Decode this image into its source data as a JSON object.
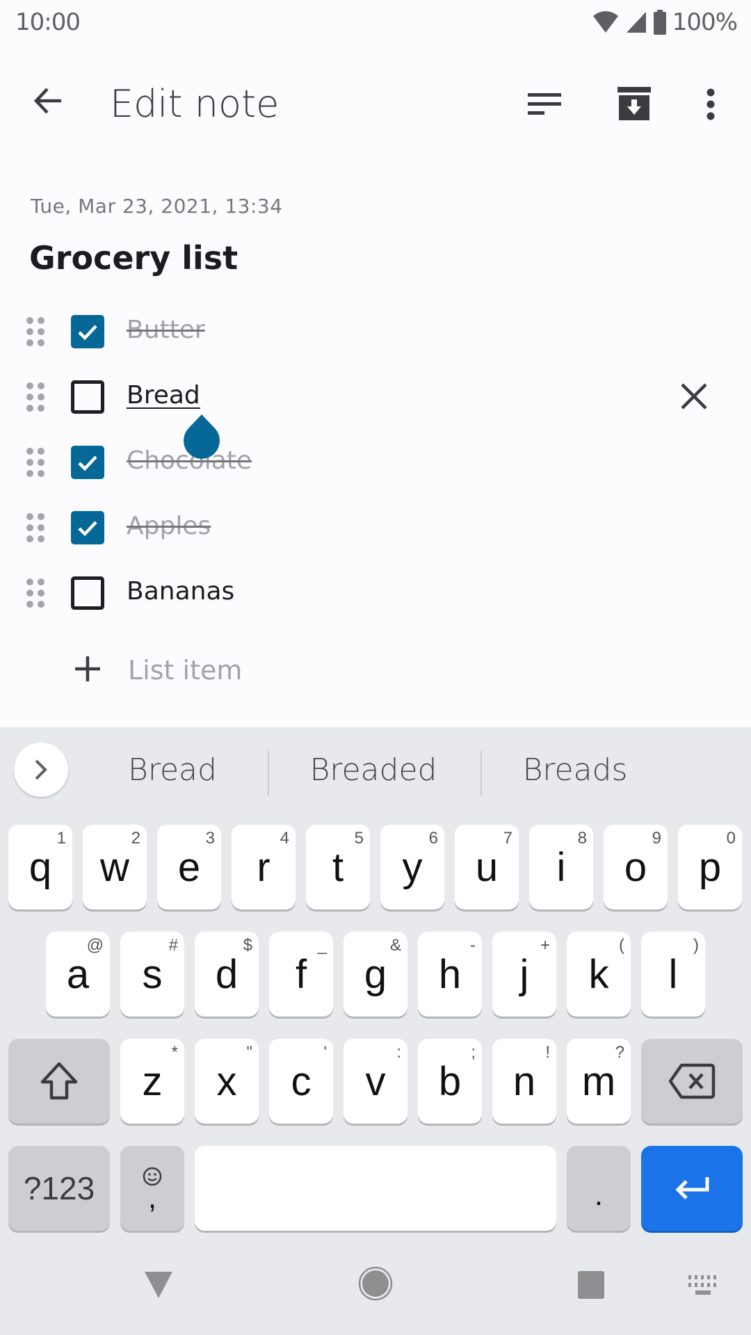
{
  "status_bar": {
    "time": "10:00",
    "battery": "100%",
    "icons": [
      "wifi-icon",
      "cell-signal-icon",
      "battery-icon"
    ]
  },
  "app_bar": {
    "title": "Edit note",
    "back_icon": "arrow-back-icon",
    "actions": [
      "sort-icon",
      "archive-icon",
      "more-vert-icon"
    ]
  },
  "note": {
    "date": "Tue, Mar 23, 2021, 13:34",
    "title": "Grocery list",
    "items": [
      {
        "text": "Butter",
        "checked": true
      },
      {
        "text": "Bread",
        "checked": false,
        "editing": true
      },
      {
        "text": "Chocolate",
        "checked": true
      },
      {
        "text": "Apples",
        "checked": true
      },
      {
        "text": "Bananas",
        "checked": false
      }
    ],
    "add_item_placeholder": "List item"
  },
  "keyboard": {
    "suggestions": [
      "Bread",
      "Breaded",
      "Breads"
    ],
    "row1": [
      {
        "key": "q",
        "hint": "1"
      },
      {
        "key": "w",
        "hint": "2"
      },
      {
        "key": "e",
        "hint": "3"
      },
      {
        "key": "r",
        "hint": "4"
      },
      {
        "key": "t",
        "hint": "5"
      },
      {
        "key": "y",
        "hint": "6"
      },
      {
        "key": "u",
        "hint": "7"
      },
      {
        "key": "i",
        "hint": "8"
      },
      {
        "key": "o",
        "hint": "9"
      },
      {
        "key": "p",
        "hint": "0"
      }
    ],
    "row2": [
      {
        "key": "a",
        "hint": "@"
      },
      {
        "key": "s",
        "hint": "#"
      },
      {
        "key": "d",
        "hint": "$"
      },
      {
        "key": "f",
        "hint": "_"
      },
      {
        "key": "g",
        "hint": "&"
      },
      {
        "key": "h",
        "hint": "-"
      },
      {
        "key": "j",
        "hint": "+"
      },
      {
        "key": "k",
        "hint": "("
      },
      {
        "key": "l",
        "hint": ")"
      }
    ],
    "row3": [
      {
        "key": "z",
        "hint": "*"
      },
      {
        "key": "x",
        "hint": "\""
      },
      {
        "key": "c",
        "hint": "'"
      },
      {
        "key": "v",
        "hint": ":"
      },
      {
        "key": "b",
        "hint": ";"
      },
      {
        "key": "n",
        "hint": "!"
      },
      {
        "key": "m",
        "hint": "?"
      }
    ],
    "symbols_key": "?123",
    "comma_key": ",",
    "period_key": "."
  },
  "colors": {
    "accent": "#056896",
    "enter_key": "#1a73e8",
    "keyboard_bg": "#e8e9ed"
  }
}
